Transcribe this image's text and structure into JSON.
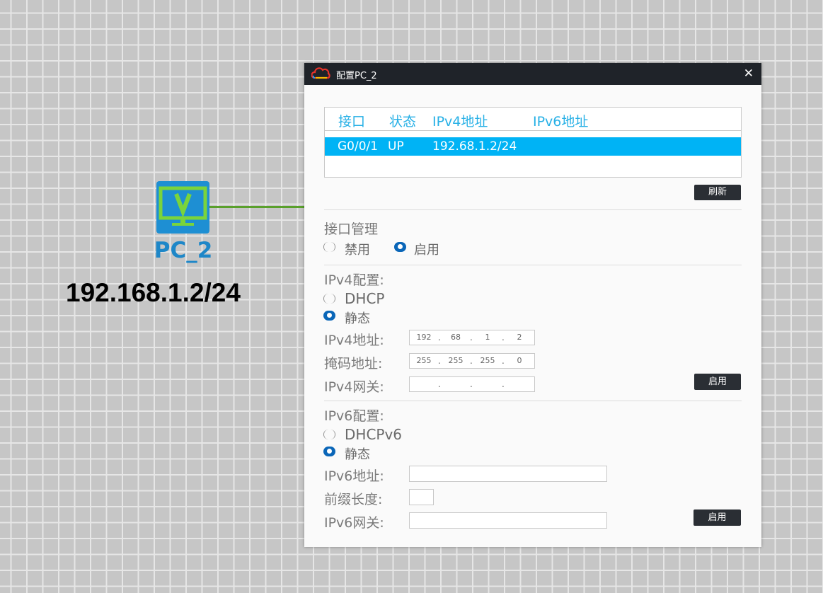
{
  "canvas": {
    "device_name": "PC_2",
    "device_ip": "192.168.1.2/24"
  },
  "dialog": {
    "title": "配置PC_2",
    "close_glyph": "✕",
    "table": {
      "headers": [
        "接口",
        "状态",
        "IPv4地址",
        "IPv6地址"
      ],
      "rows": [
        {
          "interface": "G0/0/1",
          "status": "UP",
          "ipv4": "192.68.1.2/24",
          "ipv6": ""
        }
      ]
    },
    "refresh_label": "刷新",
    "iface_mgmt": {
      "title": "接口管理",
      "disable_label": "禁用",
      "enable_label": "启用",
      "selected": "enable"
    },
    "ipv4": {
      "title": "IPv4配置:",
      "dhcp_label": "DHCP",
      "static_label": "静态",
      "selected": "static",
      "addr_label": "IPv4地址:",
      "addr": [
        "192",
        "68",
        "1",
        "2"
      ],
      "mask_label": "掩码地址:",
      "mask": [
        "255",
        "255",
        "255",
        "0"
      ],
      "gw_label": "IPv4网关:",
      "gw": [
        "",
        "",
        "",
        ""
      ],
      "apply_label": "启用"
    },
    "ipv6": {
      "title": "IPv6配置:",
      "dhcp_label": "DHCPv6",
      "static_label": "静态",
      "selected": "static",
      "addr_label": "IPv6地址:",
      "addr_value": "",
      "prefix_label": "前缀长度:",
      "prefix_value": "",
      "gw_label": "IPv6网关:",
      "gw_value": "",
      "apply_label": "启用"
    }
  },
  "colors": {
    "titlebar": "#1f2329",
    "accent_blue": "#00b3f5",
    "header_text": "#27b0e6",
    "radio_on": "#0a66b8",
    "device_icon": "#1e8fd3",
    "link": "#5aa02c"
  },
  "icons": {
    "title_icon": "cloud-logo-icon",
    "device_icon": "monitor-icon"
  }
}
